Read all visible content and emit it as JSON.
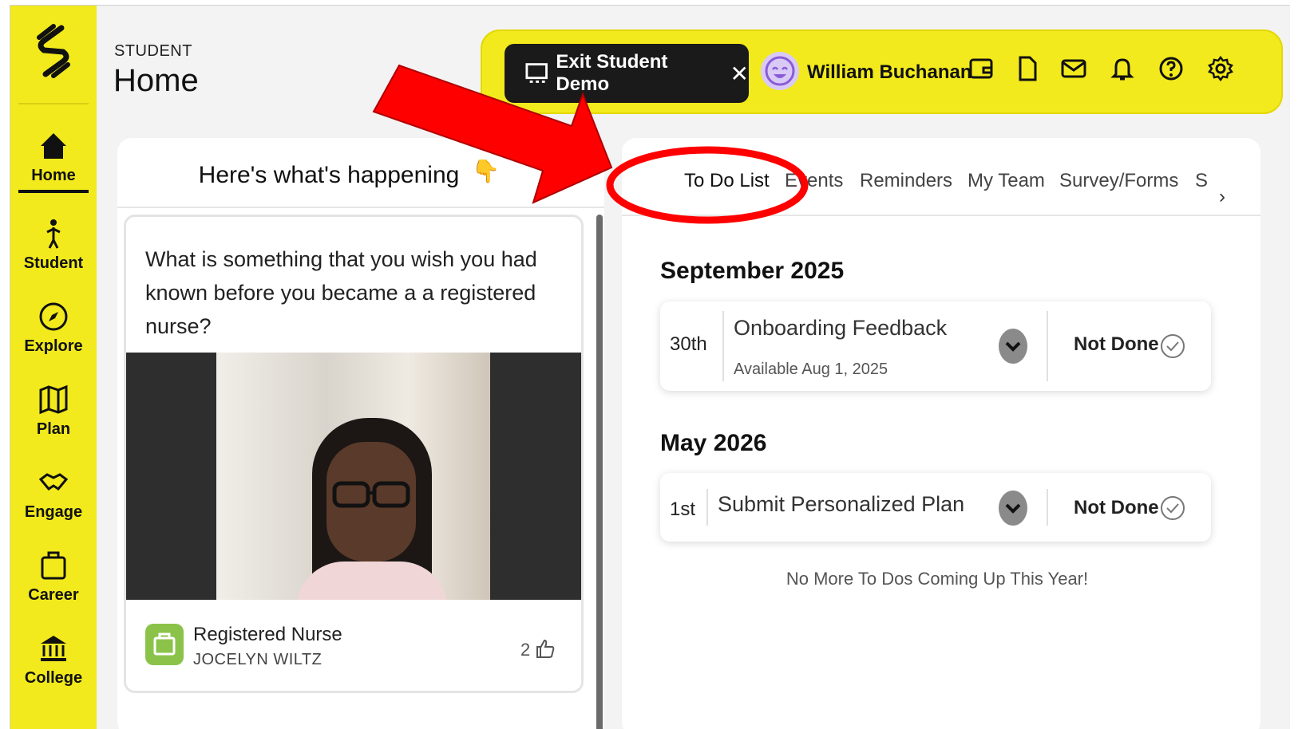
{
  "sidebar": {
    "items": [
      {
        "label": "Home",
        "icon": "home-icon"
      },
      {
        "label": "Student",
        "icon": "student-icon"
      },
      {
        "label": "Explore",
        "icon": "compass-icon"
      },
      {
        "label": "Plan",
        "icon": "map-icon"
      },
      {
        "label": "Engage",
        "icon": "handshake-icon"
      },
      {
        "label": "Career",
        "icon": "briefcase-icon"
      },
      {
        "label": "College",
        "icon": "bank-icon"
      }
    ]
  },
  "header": {
    "crumb": "STUDENT",
    "title": "Home",
    "exit_label": "Exit Student Demo",
    "exit_close": "✕",
    "user_name": "William Buchanan"
  },
  "feed": {
    "title": "Here's what's happening",
    "question": "What is something that you wish you had known before you became a a registered nurse?",
    "job_title": "Registered Nurse",
    "author": "JOCELYN WILTZ",
    "likes": "2"
  },
  "tabs": [
    {
      "label": "To Do List"
    },
    {
      "label": "Events"
    },
    {
      "label": "Reminders"
    },
    {
      "label": "My Team"
    },
    {
      "label": "Survey/Forms"
    },
    {
      "label": "S"
    }
  ],
  "todo": {
    "groups": [
      {
        "month": "September 2025",
        "day": "30th",
        "title": "Onboarding Feedback",
        "sub": "Available Aug 1, 2025",
        "status": "Not Done"
      },
      {
        "month": "May 2026",
        "day": "1st",
        "title": "Submit Personalized Plan",
        "sub": "",
        "status": "Not Done"
      }
    ],
    "empty_message": "No More To Dos Coming Up This Year!"
  },
  "colors": {
    "accent": "#f2ea1c",
    "annotation": "#ff0000"
  }
}
